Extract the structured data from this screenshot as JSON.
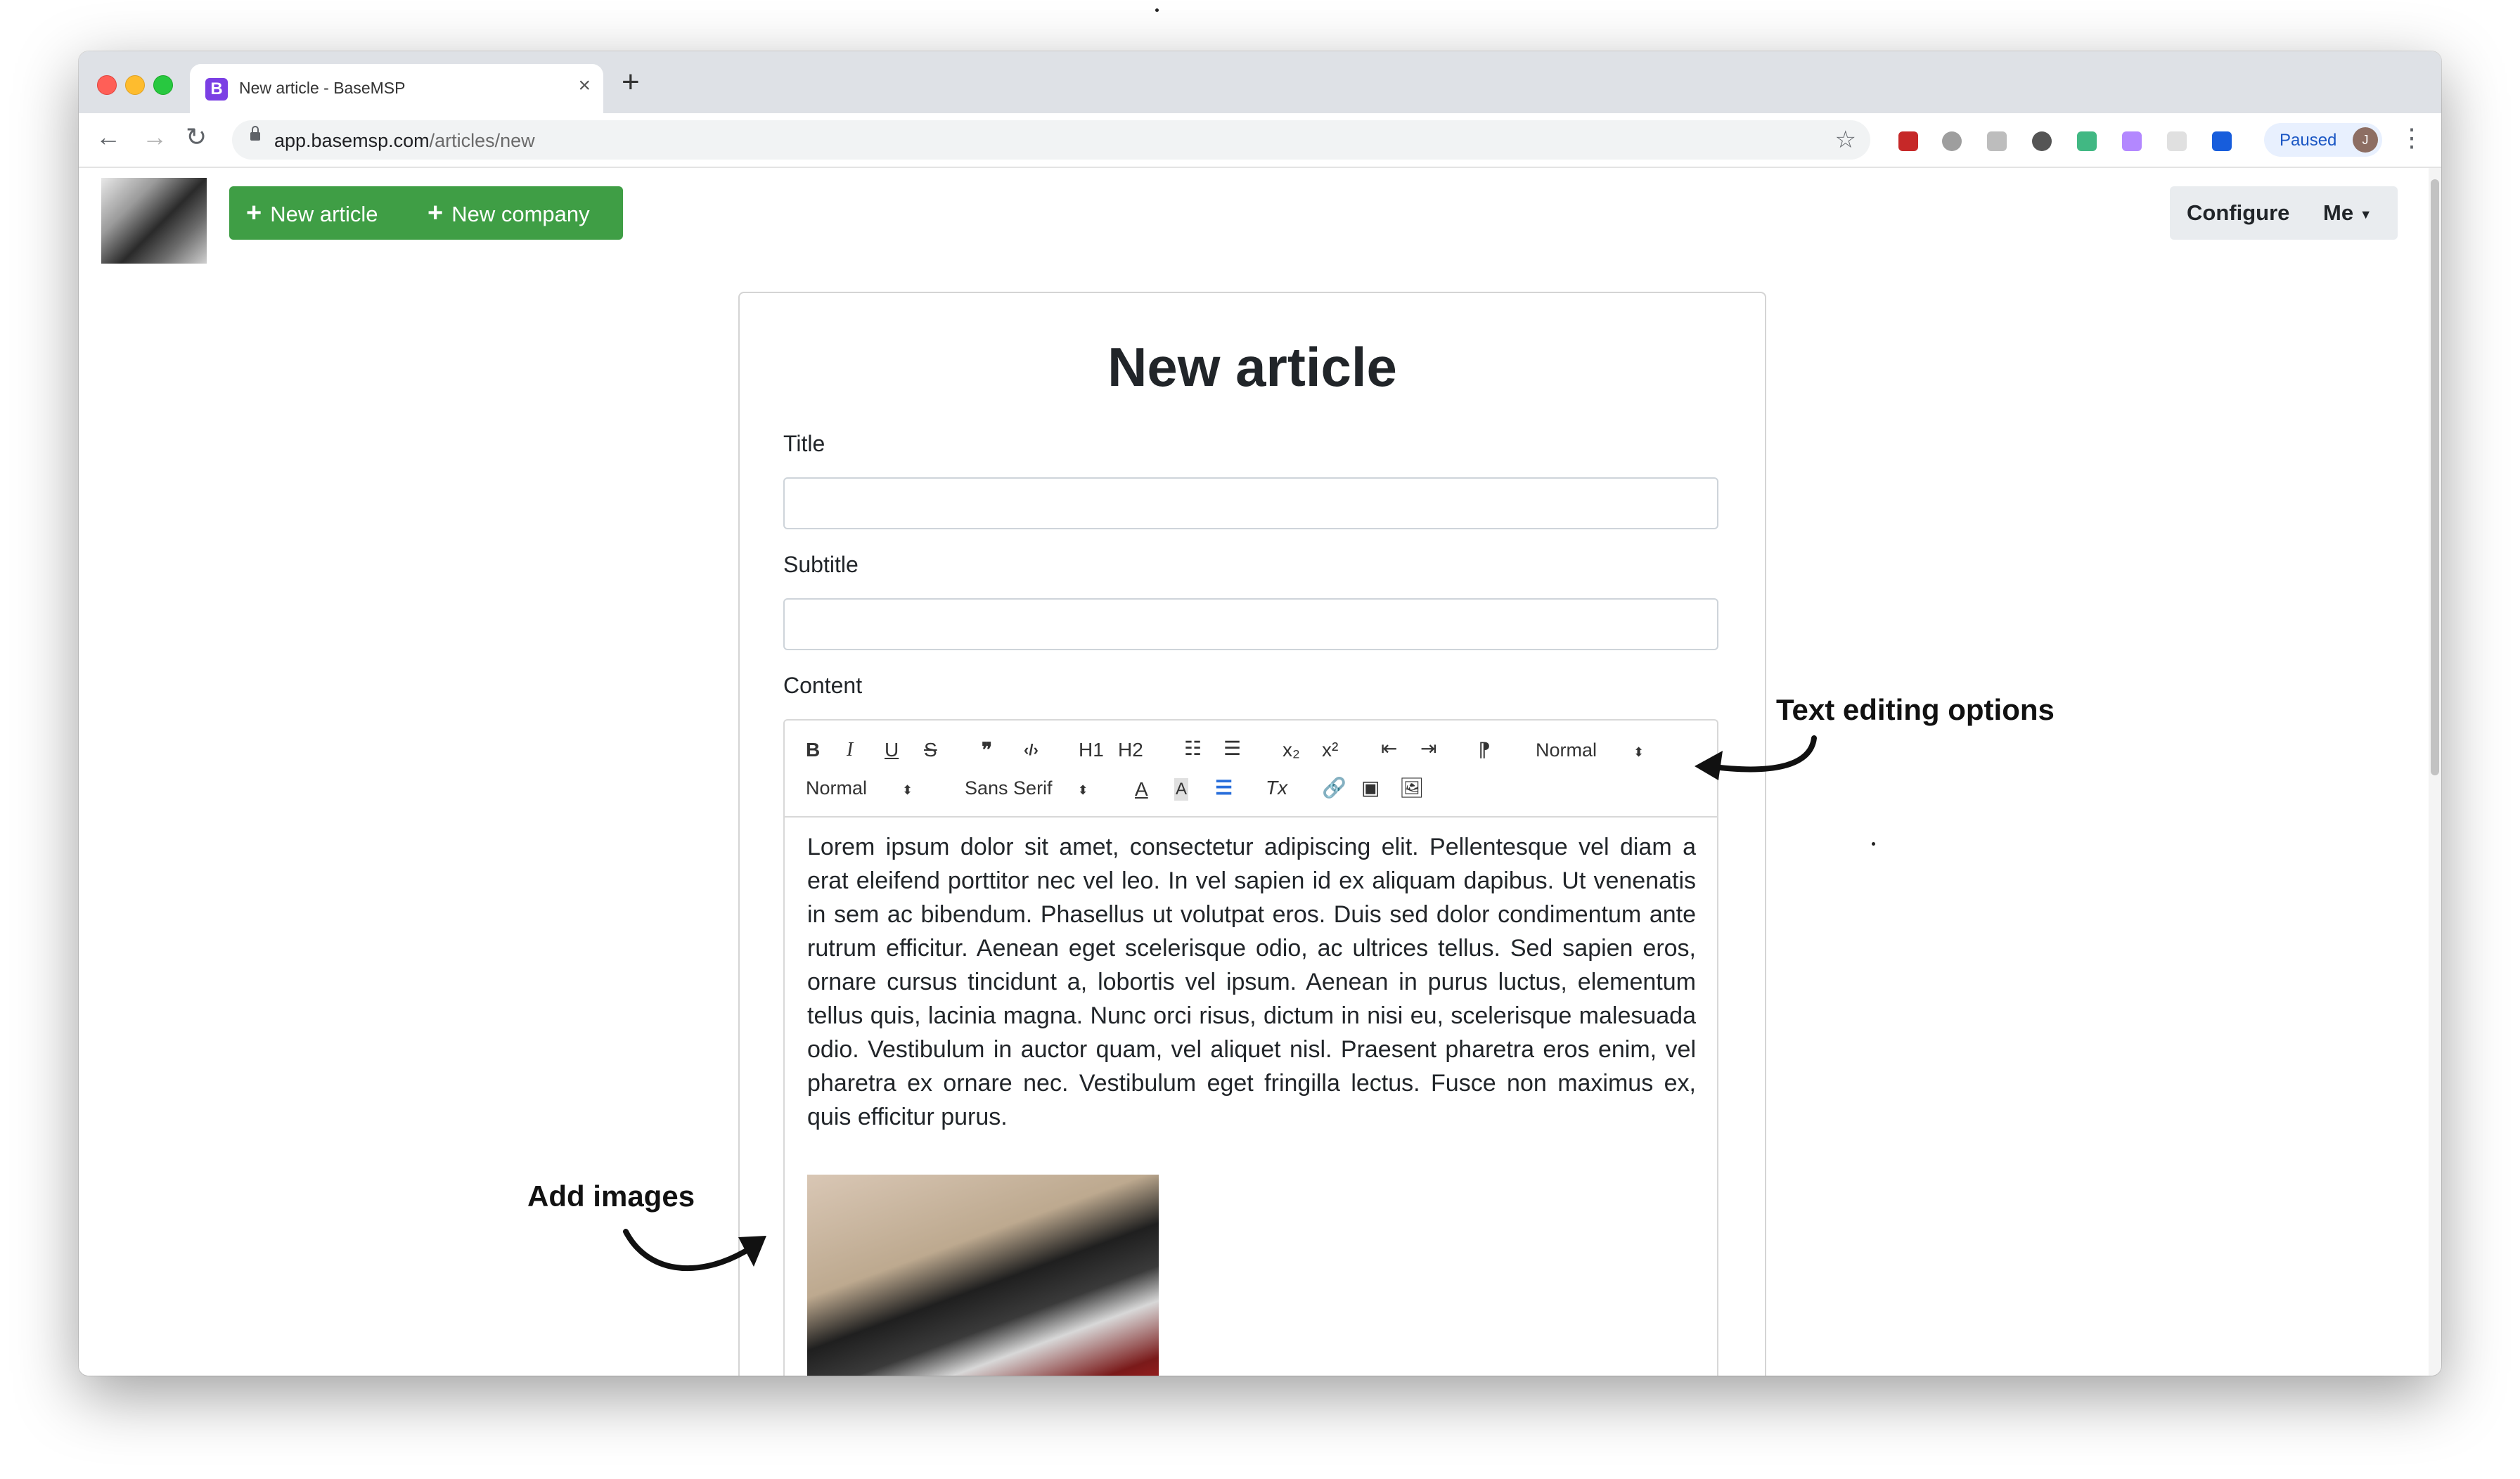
{
  "browser": {
    "tab_title": "New article - BaseMSP",
    "favicon_letter": "B",
    "url_host": "app.basemsp.com",
    "url_path": "/articles/new",
    "profile_status": "Paused",
    "profile_initial": "J"
  },
  "header": {
    "new_article_label": "New article",
    "new_company_label": "New company",
    "configure_label": "Configure",
    "me_label": "Me"
  },
  "form": {
    "heading": "New article",
    "title_label": "Title",
    "title_value": "",
    "subtitle_label": "Subtitle",
    "subtitle_value": "",
    "content_label": "Content"
  },
  "editor": {
    "toolbar": {
      "bold": "B",
      "italic": "I",
      "underline": "U",
      "strike": "S",
      "quote": "❞",
      "code": "‹/›",
      "h1": "H1",
      "h2": "H2",
      "subscript": "x₂",
      "superscript": "x²",
      "direction": "⁋",
      "header_select": "Normal",
      "size_select": "Normal",
      "font_select": "Sans Serif",
      "font_color": "A",
      "clean": "Tx"
    },
    "content_text": "Lorem ipsum dolor sit amet, consectetur adipiscing elit. Pellentesque vel diam a erat eleifend porttitor nec vel leo. In vel sapien id ex aliquam dapibus. Ut venenatis in sem ac bibendum. Phasellus ut volutpat eros. Duis sed dolor condimentum ante rutrum efficitur. Aenean eget scelerisque odio, ac ultrices tellus. Sed sapien eros, ornare cursus tincidunt a, lobortis vel ipsum. Aenean in purus luctus, elementum tellus quis, lacinia magna. Nunc orci risus, dictum in nisi eu, scelerisque malesuada odio. Vestibulum in auctor quam, vel aliquet nisl. Praesent pharetra eros enim, vel pharetra ex ornare nec. Vestibulum eget fringilla lectus. Fusce non maximus ex, quis efficitur purus."
  },
  "annotations": {
    "text_editing": "Text editing options",
    "add_images": "Add images"
  },
  "colors": {
    "primary_green": "#3f9e45",
    "secondary_gray": "#e9ecef",
    "favicon_purple": "#7b3fe4",
    "accent_blue": "#2a6fdb"
  }
}
